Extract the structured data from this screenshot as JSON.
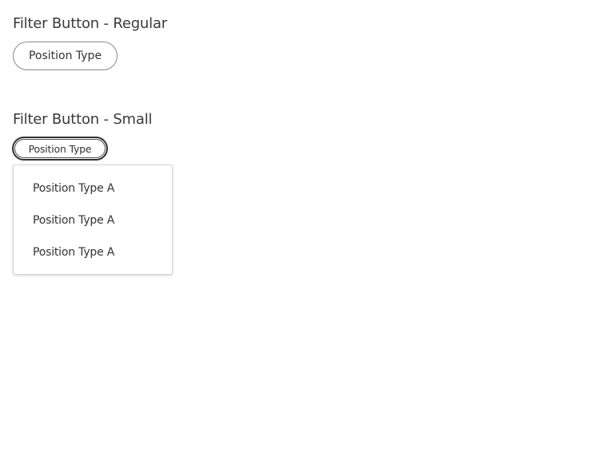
{
  "sections": {
    "regular": {
      "title": "Filter Button - Regular",
      "button_label": "Position Type"
    },
    "small": {
      "title": "Filter Button - Small",
      "button_label": "Position Type",
      "dropdown_items": [
        {
          "label": "Position Type A"
        },
        {
          "label": "Position Type A"
        },
        {
          "label": "Position Type A"
        }
      ]
    }
  },
  "colors": {
    "text": "#333333",
    "border_regular": "#8a8a8a",
    "border_small_active": "#333333",
    "dropdown_border": "#d6d6d6"
  }
}
